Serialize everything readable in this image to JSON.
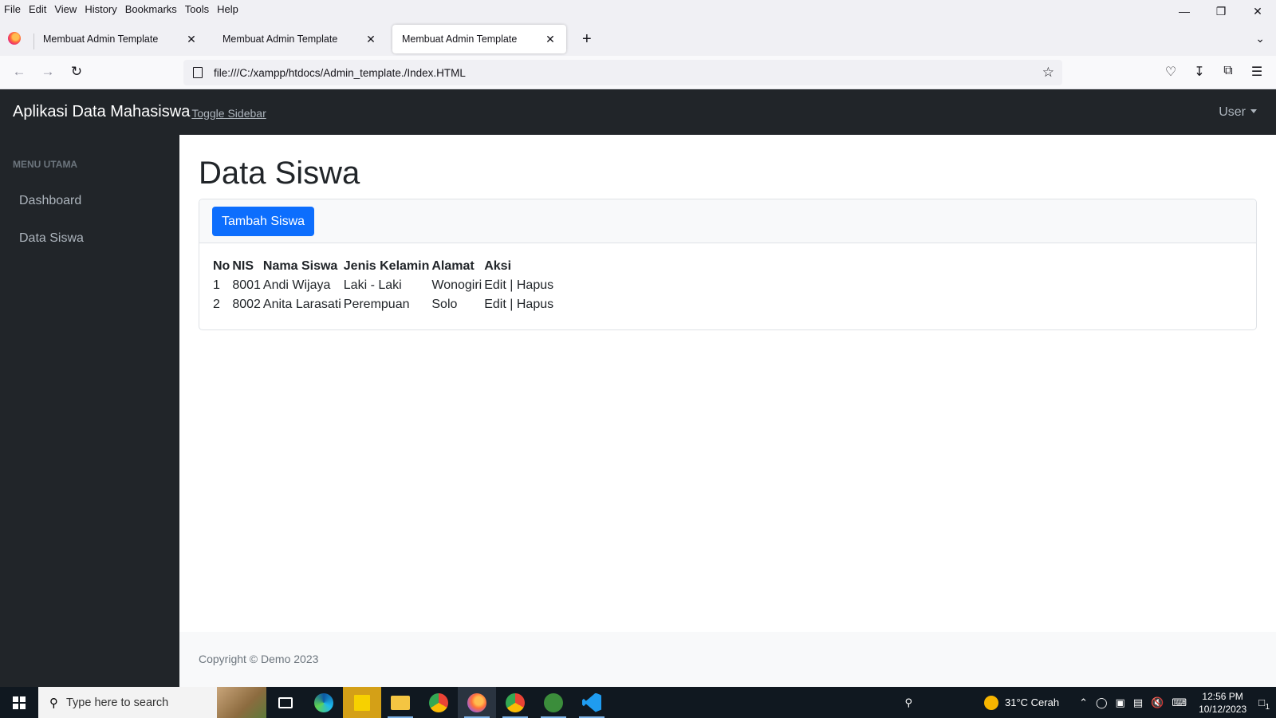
{
  "browser": {
    "menu": [
      "File",
      "Edit",
      "View",
      "History",
      "Bookmarks",
      "Tools",
      "Help"
    ],
    "tabs": [
      {
        "label": "Membuat Admin Template"
      },
      {
        "label": "Membuat Admin Template"
      },
      {
        "label": "Membuat Admin Template"
      }
    ],
    "url": "file:///C:/xampp/htdocs/Admin_template./Index.HTML"
  },
  "app": {
    "brand": "Aplikasi Data Mahasiswa",
    "toggle_label": "Toggle Sidebar",
    "user_label": "User",
    "sidebar": {
      "heading": "MENU UTAMA",
      "items": [
        {
          "label": "Dashboard"
        },
        {
          "label": "Data Siswa"
        }
      ]
    },
    "page_title": "Data Siswa",
    "add_button": "Tambah Siswa",
    "table": {
      "headers": [
        "No",
        "NIS",
        "Nama Siswa",
        "Jenis Kelamin",
        "Alamat",
        "Aksi"
      ],
      "rows": [
        {
          "no": "1",
          "nis": "8001",
          "nama": "Andi Wijaya",
          "jk": "Laki - Laki",
          "alamat": "Wonogiri",
          "edit": "Edit",
          "sep": "|",
          "hapus": "Hapus"
        },
        {
          "no": "2",
          "nis": "8002",
          "nama": "Anita Larasati",
          "jk": "Perempuan",
          "alamat": "Solo",
          "edit": "Edit",
          "sep": "|",
          "hapus": "Hapus"
        }
      ]
    },
    "footer": "Copyright © Demo 2023"
  },
  "taskbar": {
    "search_placeholder": "Type here to search",
    "weather": "31°C  Cerah",
    "time": "12:56 PM",
    "date": "10/12/2023",
    "notification_count": "1"
  },
  "colors": {
    "primary": "#0d6efd",
    "dark": "#212529"
  }
}
